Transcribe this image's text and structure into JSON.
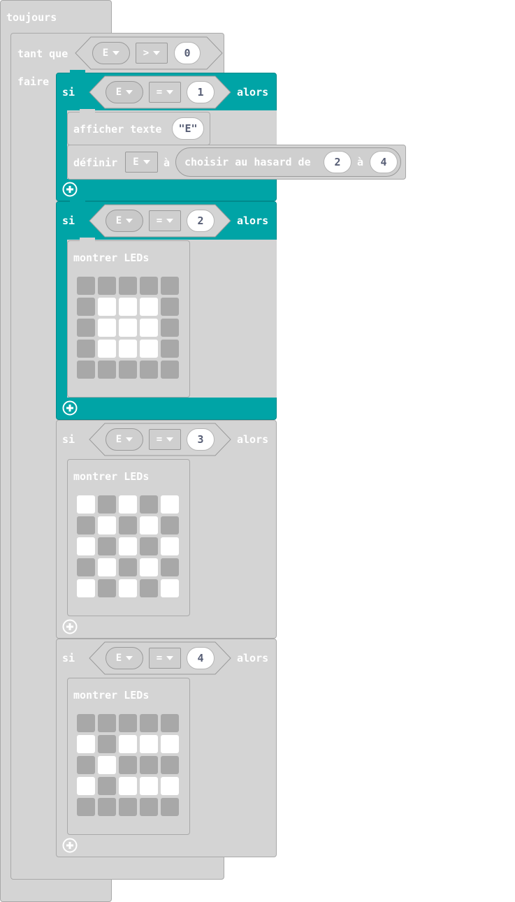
{
  "forever_label": "toujours",
  "while_block": {
    "label": "tant que",
    "do_label": "faire",
    "condition": {
      "variable": "E",
      "operator": ">",
      "value": "0"
    }
  },
  "if1": {
    "si_label": "si",
    "then_label": "alors",
    "condition": {
      "variable": "E",
      "operator": "=",
      "value": "1"
    },
    "show_string": {
      "label": "afficher texte",
      "text": "\"E\""
    },
    "set_block": {
      "label": "définir",
      "variable": "E",
      "to_label": "à",
      "random_label": "choisir au hasard de",
      "from_value": "2",
      "to_value_label": "à",
      "to_value": "4"
    }
  },
  "if2": {
    "si_label": "si",
    "then_label": "alors",
    "condition": {
      "variable": "E",
      "operator": "=",
      "value": "2"
    },
    "show_leds_label": "montrer LEDs",
    "leds": [
      [
        0,
        0,
        0,
        0,
        0
      ],
      [
        0,
        1,
        1,
        1,
        0
      ],
      [
        0,
        1,
        1,
        1,
        0
      ],
      [
        0,
        1,
        1,
        1,
        0
      ],
      [
        0,
        0,
        0,
        0,
        0
      ]
    ]
  },
  "if3": {
    "si_label": "si",
    "then_label": "alors",
    "condition": {
      "variable": "E",
      "operator": "=",
      "value": "3"
    },
    "show_leds_label": "montrer LEDs",
    "leds": [
      [
        1,
        0,
        1,
        0,
        1
      ],
      [
        0,
        1,
        0,
        1,
        0
      ],
      [
        1,
        0,
        1,
        0,
        1
      ],
      [
        0,
        1,
        0,
        1,
        0
      ],
      [
        1,
        0,
        1,
        0,
        1
      ]
    ]
  },
  "if4": {
    "si_label": "si",
    "then_label": "alors",
    "condition": {
      "variable": "E",
      "operator": "=",
      "value": "4"
    },
    "show_leds_label": "montrer LEDs",
    "leds": [
      [
        0,
        0,
        0,
        0,
        0
      ],
      [
        1,
        0,
        1,
        1,
        1
      ],
      [
        0,
        1,
        0,
        0,
        0
      ],
      [
        1,
        0,
        1,
        1,
        1
      ],
      [
        0,
        0,
        0,
        0,
        0
      ]
    ]
  },
  "colors": {
    "block_gray": "#d4d4d4",
    "logic_teal": "#00a4a6",
    "led_off": "#a8a8a8",
    "led_on": "#ffffff",
    "number_text": "#575e75"
  },
  "icons": {
    "add": "plus-circle-icon",
    "dropdown": "dropdown-arrow-icon"
  }
}
